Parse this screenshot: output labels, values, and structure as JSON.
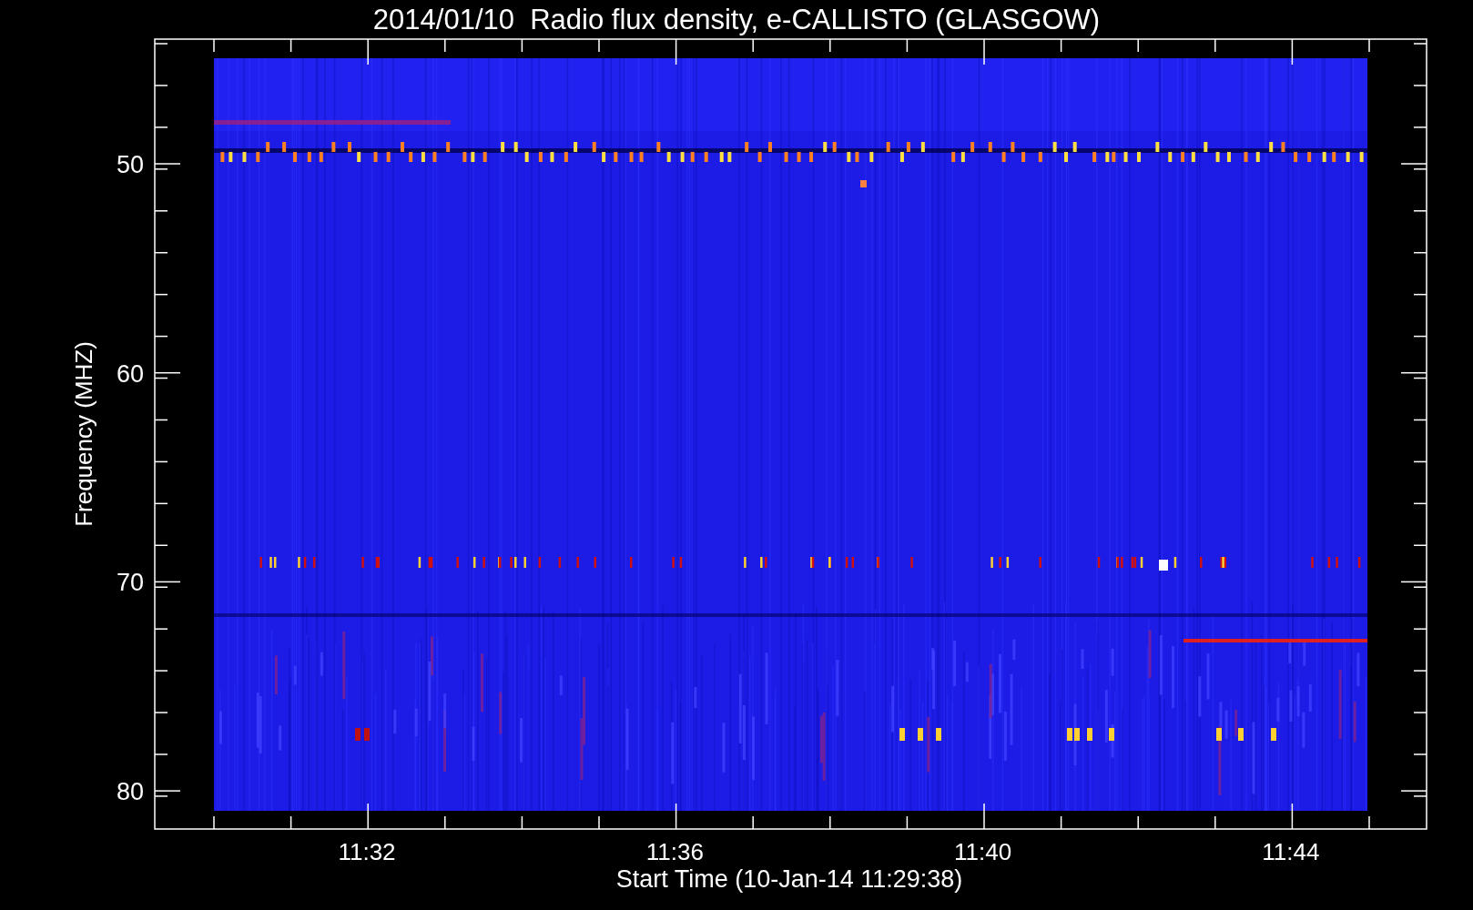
{
  "title": "2014/01/10  Radio flux density, e-CALLISTO (GLASGOW)",
  "y_axis": {
    "label": "Frequency (MHZ)",
    "ticks": [
      "50",
      "60",
      "70",
      "80"
    ]
  },
  "x_axis": {
    "label": "Start Time (10-Jan-14 11:29:38)",
    "ticks": [
      "11:32",
      "11:36",
      "11:40",
      "11:44"
    ]
  }
}
